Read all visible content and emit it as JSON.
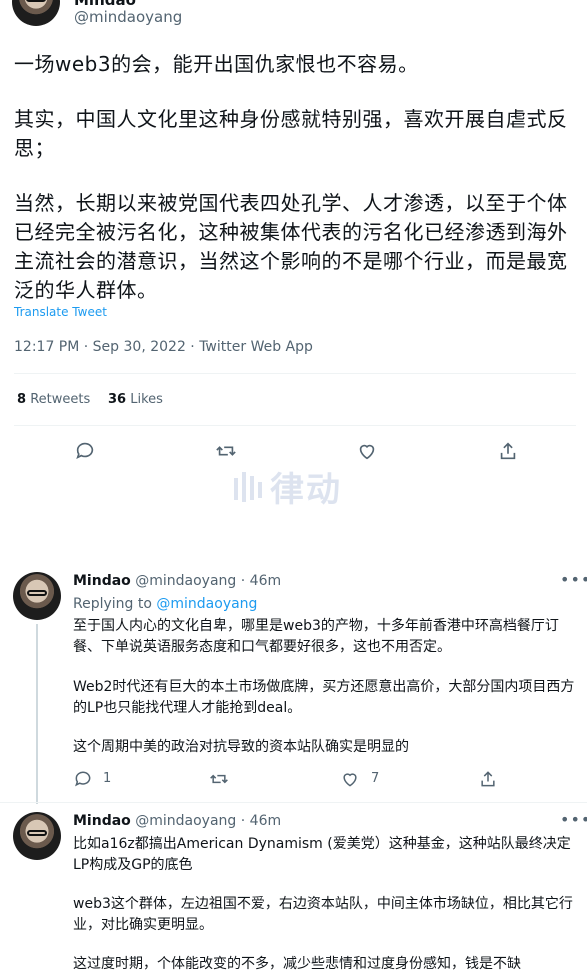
{
  "main_tweet": {
    "author_name": "Mindao",
    "handle": "@mindaoyang",
    "paragraphs": [
      "一场web3的会，能开出国仇家恨也不容易。",
      "其实，中国人文化里这种身份感就特别强，喜欢开展自虐式反思；",
      "当然，长期以来被党国代表四处孔学、人才渗透，以至于个体已经完全被污名化，这种被集体代表的污名化已经渗透到海外主流社会的潜意识，当然这个影响的不是哪个行业，而是最宽泛的华人群体。"
    ],
    "translate": "Translate Tweet",
    "timestamp": "12:17 PM · Sep 30, 2022 · Twitter Web App",
    "stats": {
      "retweets_count": "8",
      "retweets_label": "Retweets",
      "likes_count": "36",
      "likes_label": "Likes"
    }
  },
  "watermark": {
    "text": "律动"
  },
  "replies": [
    {
      "name": "Mindao",
      "handle_time": "@mindaoyang · 46m",
      "replying_prefix": "Replying to",
      "replying_to": "@mindaoyang",
      "paragraphs": [
        "至于国人内心的文化自卑，哪里是web3的产物，十多年前香港中环高档餐厅订餐、下单说英语服务态度和口气都要好很多，这也不用否定。",
        "Web2时代还有巨大的本土市场做底牌，买方还愿意出高价，大部分国内项目西方的LP也只能找代理人才能抢到deal。",
        "这个周期中美的政治对抗导致的资本站队确实是明显的"
      ],
      "reply_count": "1",
      "like_count": "7"
    },
    {
      "name": "Mindao",
      "handle_time": "@mindaoyang · 46m",
      "paragraphs": [
        "比如a16z都搞出American Dynamism (爱美党）这种基金，这种站队最终决定LP构成及GP的底色",
        "web3这个群体，左边祖国不爱，右边资本站队，中间主体市场缺位，相比其它行业，对比确实更明显。",
        "这过度时期，个体能改变的不多，减少些悲情和过度身份感知，钱是不缺"
      ]
    }
  ]
}
